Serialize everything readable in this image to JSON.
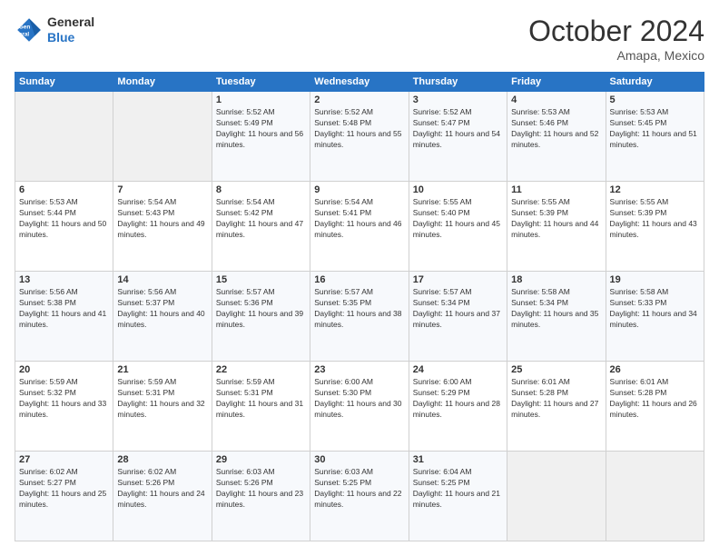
{
  "header": {
    "logo_line1": "General",
    "logo_line2": "Blue",
    "month": "October 2024",
    "location": "Amapa, Mexico"
  },
  "weekdays": [
    "Sunday",
    "Monday",
    "Tuesday",
    "Wednesday",
    "Thursday",
    "Friday",
    "Saturday"
  ],
  "weeks": [
    [
      {
        "day": "",
        "info": ""
      },
      {
        "day": "",
        "info": ""
      },
      {
        "day": "1",
        "info": "Sunrise: 5:52 AM\nSunset: 5:49 PM\nDaylight: 11 hours and 56 minutes."
      },
      {
        "day": "2",
        "info": "Sunrise: 5:52 AM\nSunset: 5:48 PM\nDaylight: 11 hours and 55 minutes."
      },
      {
        "day": "3",
        "info": "Sunrise: 5:52 AM\nSunset: 5:47 PM\nDaylight: 11 hours and 54 minutes."
      },
      {
        "day": "4",
        "info": "Sunrise: 5:53 AM\nSunset: 5:46 PM\nDaylight: 11 hours and 52 minutes."
      },
      {
        "day": "5",
        "info": "Sunrise: 5:53 AM\nSunset: 5:45 PM\nDaylight: 11 hours and 51 minutes."
      }
    ],
    [
      {
        "day": "6",
        "info": "Sunrise: 5:53 AM\nSunset: 5:44 PM\nDaylight: 11 hours and 50 minutes."
      },
      {
        "day": "7",
        "info": "Sunrise: 5:54 AM\nSunset: 5:43 PM\nDaylight: 11 hours and 49 minutes."
      },
      {
        "day": "8",
        "info": "Sunrise: 5:54 AM\nSunset: 5:42 PM\nDaylight: 11 hours and 47 minutes."
      },
      {
        "day": "9",
        "info": "Sunrise: 5:54 AM\nSunset: 5:41 PM\nDaylight: 11 hours and 46 minutes."
      },
      {
        "day": "10",
        "info": "Sunrise: 5:55 AM\nSunset: 5:40 PM\nDaylight: 11 hours and 45 minutes."
      },
      {
        "day": "11",
        "info": "Sunrise: 5:55 AM\nSunset: 5:39 PM\nDaylight: 11 hours and 44 minutes."
      },
      {
        "day": "12",
        "info": "Sunrise: 5:55 AM\nSunset: 5:39 PM\nDaylight: 11 hours and 43 minutes."
      }
    ],
    [
      {
        "day": "13",
        "info": "Sunrise: 5:56 AM\nSunset: 5:38 PM\nDaylight: 11 hours and 41 minutes."
      },
      {
        "day": "14",
        "info": "Sunrise: 5:56 AM\nSunset: 5:37 PM\nDaylight: 11 hours and 40 minutes."
      },
      {
        "day": "15",
        "info": "Sunrise: 5:57 AM\nSunset: 5:36 PM\nDaylight: 11 hours and 39 minutes."
      },
      {
        "day": "16",
        "info": "Sunrise: 5:57 AM\nSunset: 5:35 PM\nDaylight: 11 hours and 38 minutes."
      },
      {
        "day": "17",
        "info": "Sunrise: 5:57 AM\nSunset: 5:34 PM\nDaylight: 11 hours and 37 minutes."
      },
      {
        "day": "18",
        "info": "Sunrise: 5:58 AM\nSunset: 5:34 PM\nDaylight: 11 hours and 35 minutes."
      },
      {
        "day": "19",
        "info": "Sunrise: 5:58 AM\nSunset: 5:33 PM\nDaylight: 11 hours and 34 minutes."
      }
    ],
    [
      {
        "day": "20",
        "info": "Sunrise: 5:59 AM\nSunset: 5:32 PM\nDaylight: 11 hours and 33 minutes."
      },
      {
        "day": "21",
        "info": "Sunrise: 5:59 AM\nSunset: 5:31 PM\nDaylight: 11 hours and 32 minutes."
      },
      {
        "day": "22",
        "info": "Sunrise: 5:59 AM\nSunset: 5:31 PM\nDaylight: 11 hours and 31 minutes."
      },
      {
        "day": "23",
        "info": "Sunrise: 6:00 AM\nSunset: 5:30 PM\nDaylight: 11 hours and 30 minutes."
      },
      {
        "day": "24",
        "info": "Sunrise: 6:00 AM\nSunset: 5:29 PM\nDaylight: 11 hours and 28 minutes."
      },
      {
        "day": "25",
        "info": "Sunrise: 6:01 AM\nSunset: 5:28 PM\nDaylight: 11 hours and 27 minutes."
      },
      {
        "day": "26",
        "info": "Sunrise: 6:01 AM\nSunset: 5:28 PM\nDaylight: 11 hours and 26 minutes."
      }
    ],
    [
      {
        "day": "27",
        "info": "Sunrise: 6:02 AM\nSunset: 5:27 PM\nDaylight: 11 hours and 25 minutes."
      },
      {
        "day": "28",
        "info": "Sunrise: 6:02 AM\nSunset: 5:26 PM\nDaylight: 11 hours and 24 minutes."
      },
      {
        "day": "29",
        "info": "Sunrise: 6:03 AM\nSunset: 5:26 PM\nDaylight: 11 hours and 23 minutes."
      },
      {
        "day": "30",
        "info": "Sunrise: 6:03 AM\nSunset: 5:25 PM\nDaylight: 11 hours and 22 minutes."
      },
      {
        "day": "31",
        "info": "Sunrise: 6:04 AM\nSunset: 5:25 PM\nDaylight: 11 hours and 21 minutes."
      },
      {
        "day": "",
        "info": ""
      },
      {
        "day": "",
        "info": ""
      }
    ]
  ]
}
